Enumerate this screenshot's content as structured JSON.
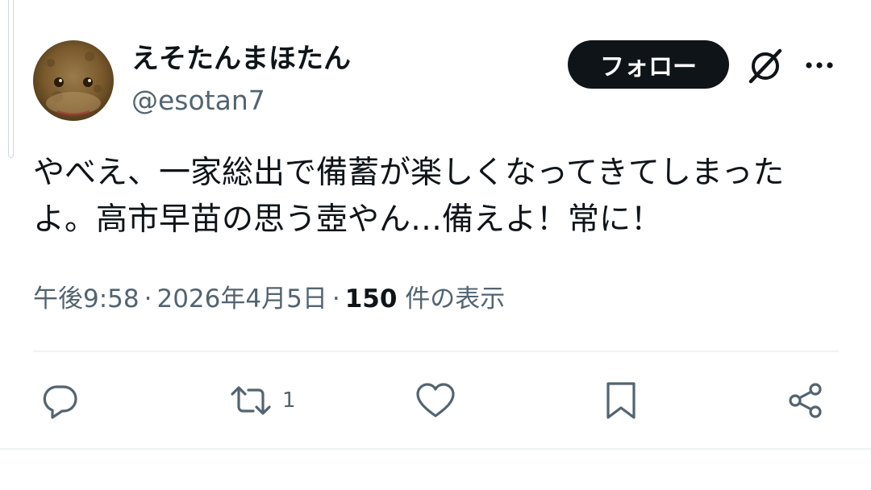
{
  "author": {
    "display_name": "えそたんまほたん",
    "handle": "@esotan7"
  },
  "header": {
    "follow_label": "フォロー",
    "grok_icon": "grok-icon",
    "more_icon": "more-icon"
  },
  "tweet": {
    "text": "やべえ、一家総出で備蓄が楽しくなってきてしまったよ。高市早苗の思う壺やん…備えよ！常に！",
    "time": "午後9:58",
    "date": "2026年4月5日",
    "views_count": "150",
    "views_label": "件の表示"
  },
  "actions": {
    "reply_icon": "reply-icon",
    "retweet_icon": "retweet-icon",
    "retweet_count": "1",
    "like_icon": "heart-icon",
    "bookmark_icon": "bookmark-icon",
    "share_icon": "share-icon"
  },
  "colors": {
    "text_primary": "#0f1419",
    "text_secondary": "#536471",
    "icon_gray": "#536471",
    "divider": "#eff3f4",
    "follow_bg": "#0f1419",
    "follow_text": "#ffffff"
  }
}
